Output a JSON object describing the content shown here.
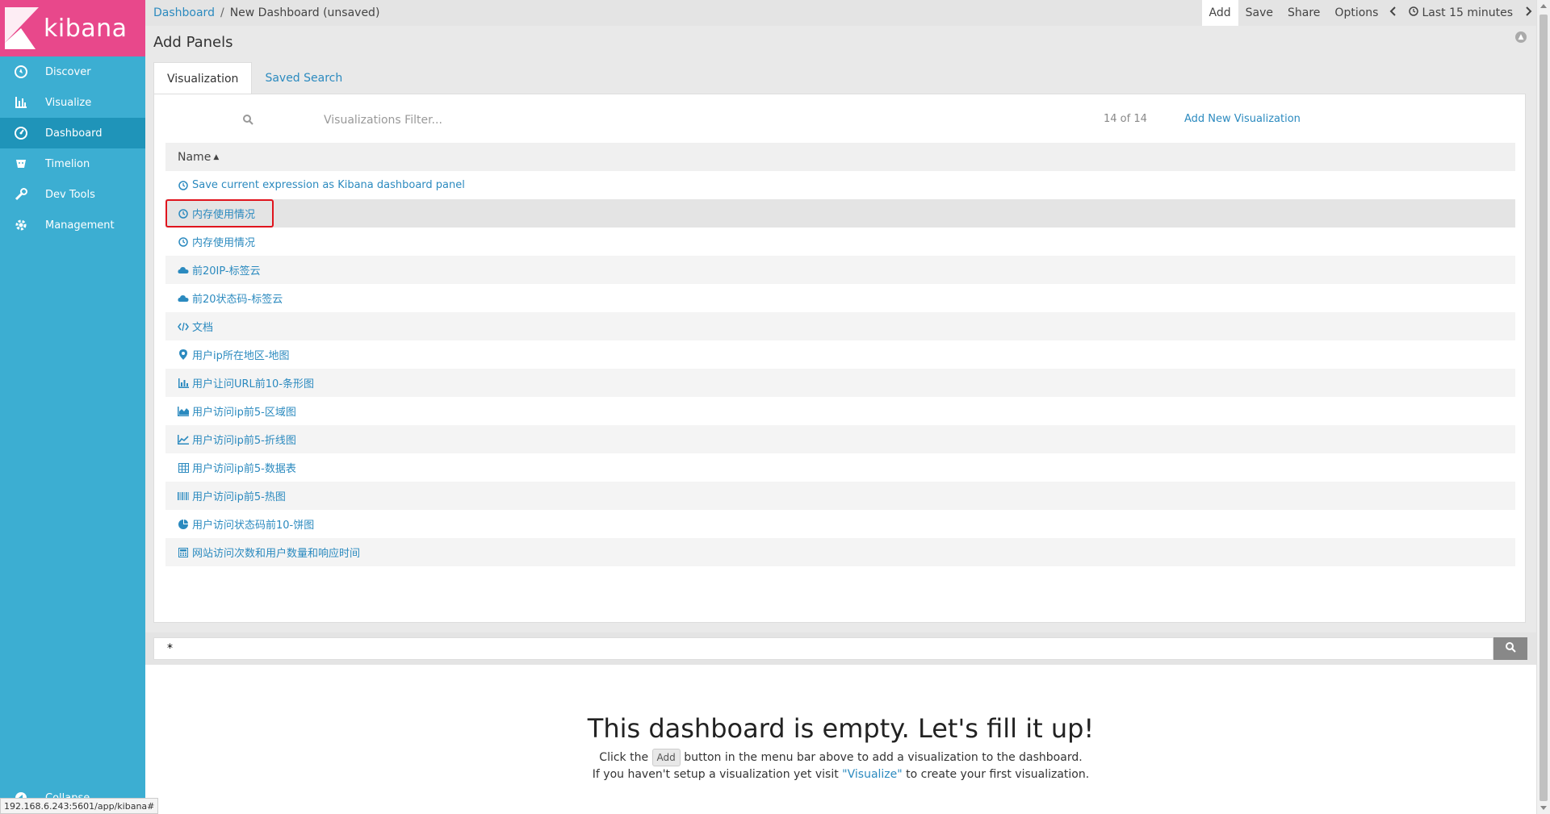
{
  "app": {
    "logo_text": "kibana",
    "brand_color": "#e8488b",
    "sidebar_color": "#3caed2"
  },
  "sidebar": {
    "items": [
      {
        "label": "Discover",
        "icon": "compass-icon"
      },
      {
        "label": "Visualize",
        "icon": "bar-chart-icon"
      },
      {
        "label": "Dashboard",
        "icon": "dashboard-icon",
        "active": true
      },
      {
        "label": "Timelion",
        "icon": "timelion-icon"
      },
      {
        "label": "Dev Tools",
        "icon": "wrench-icon"
      },
      {
        "label": "Management",
        "icon": "gear-icon"
      }
    ],
    "collapse_label": "Collapse"
  },
  "topbar": {
    "breadcrumb_root": "Dashboard",
    "breadcrumb_sep": "/",
    "breadcrumb_current": "New Dashboard (unsaved)",
    "add_label": "Add",
    "save_label": "Save",
    "share_label": "Share",
    "options_label": "Options",
    "time_label": "Last 15 minutes"
  },
  "panel": {
    "title": "Add Panels",
    "tabs": [
      "Visualization",
      "Saved Search"
    ],
    "filter_placeholder": "Visualizations Filter...",
    "count": "14 of 14",
    "add_new_label": "Add New Visualization",
    "column_header": "Name",
    "rows": [
      {
        "label": "Save current expression as Kibana dashboard panel",
        "icon": "clock-icon"
      },
      {
        "label": "内存使用情况",
        "icon": "clock-icon"
      },
      {
        "label": "内存使用情况",
        "icon": "clock-icon"
      },
      {
        "label": "前20IP-标签云",
        "icon": "cloud-icon"
      },
      {
        "label": "前20状态码-标签云",
        "icon": "cloud-icon"
      },
      {
        "label": "文档",
        "icon": "code-icon"
      },
      {
        "label": "用户ip所在地区-地图",
        "icon": "map-pin-icon"
      },
      {
        "label": "用户让问URL前10-条形图",
        "icon": "bar-chart-icon"
      },
      {
        "label": "用户访问ip前5-区域图",
        "icon": "area-chart-icon"
      },
      {
        "label": "用户访问ip前5-折线图",
        "icon": "line-chart-icon"
      },
      {
        "label": "用户访问ip前5-数据表",
        "icon": "table-icon"
      },
      {
        "label": "用户访问ip前5-热图",
        "icon": "heatmap-icon"
      },
      {
        "label": "用户访问状态码前10-饼图",
        "icon": "pie-chart-icon"
      },
      {
        "label": "网站访问次数和用户数量和响应时间",
        "icon": "calculator-icon"
      }
    ]
  },
  "query": {
    "value": "*"
  },
  "empty_state": {
    "title": "This dashboard is empty. Let's fill it up!",
    "line1_pre": "Click the",
    "line1_kbd": "Add",
    "line1_post": "button in the menu bar above to add a visualization to the dashboard.",
    "line2_pre": "If you haven't setup a visualization yet visit",
    "line2_link": "\"Visualize\"",
    "line2_post": "to create your first visualization."
  },
  "statusbar": {
    "url": "192.168.6.243:5601/app/kibana#"
  },
  "colors": {
    "link": "#2b8abf",
    "highlight_border": "#e0141d"
  }
}
